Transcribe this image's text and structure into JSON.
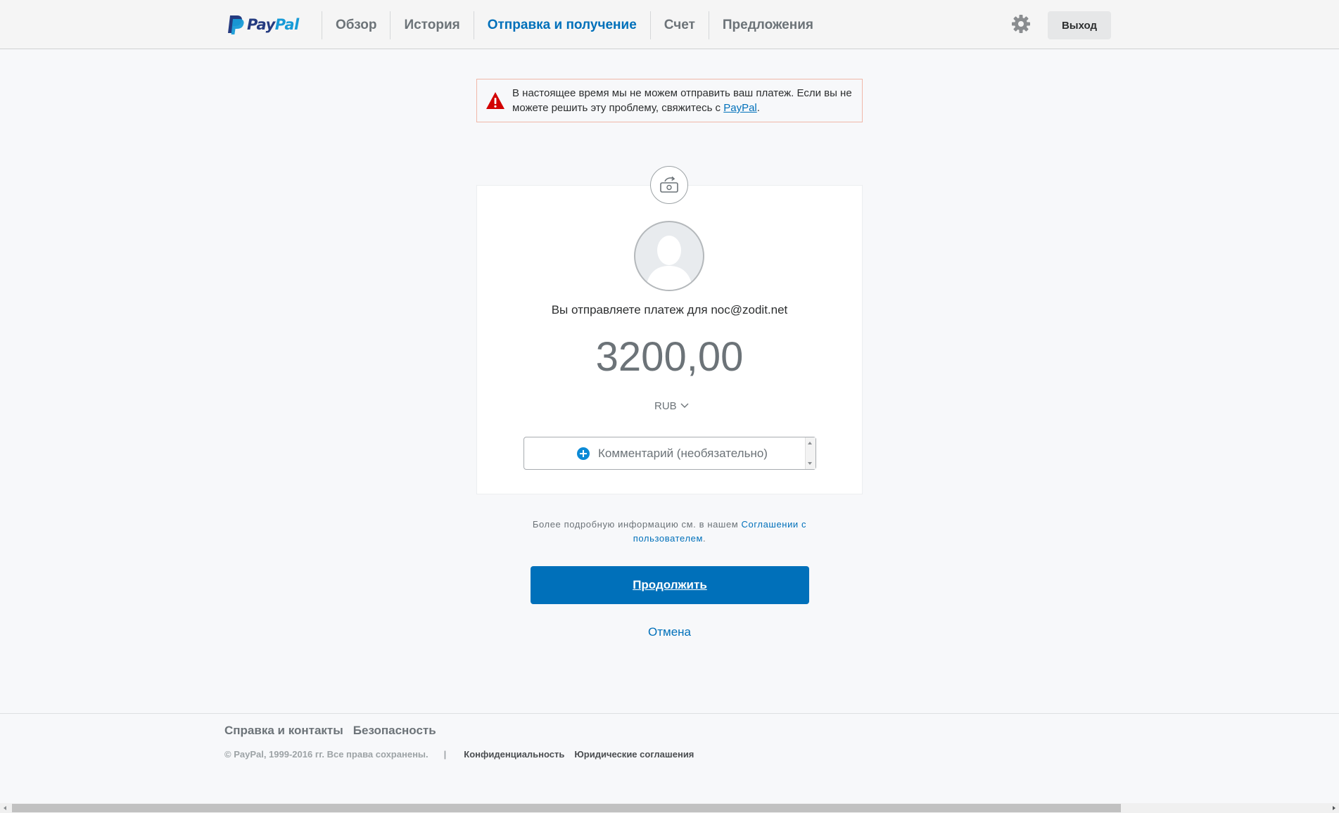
{
  "header": {
    "logo": {
      "pay": "Pay",
      "pal": "Pal"
    },
    "nav": [
      {
        "label": "Обзор",
        "active": false
      },
      {
        "label": "История",
        "active": false
      },
      {
        "label": "Отправка и получение",
        "active": true
      },
      {
        "label": "Счет",
        "active": false
      },
      {
        "label": "Предложения",
        "active": false
      }
    ],
    "settings_icon": "gear-icon",
    "logout_label": "Выход"
  },
  "alert": {
    "icon": "warning-icon",
    "text": "В настоящее время мы не можем отправить ваш платеж. Если вы не можете решить эту проблему, свяжитесь с ",
    "link_text": "PayPal",
    "suffix": "."
  },
  "payment": {
    "badge_icon": "send-money-icon",
    "recipient_text": "Вы отправляете платеж для noc@zodit.net",
    "amount": "3200,00",
    "currency": "RUB",
    "note_label": "Комментарий (необязательно)"
  },
  "agreement": {
    "text": "Более подробную информацию см. в нашем ",
    "link_text": "Соглашении с пользователем",
    "suffix": "."
  },
  "actions": {
    "continue_label": "Продолжить",
    "cancel_label": "Отмена"
  },
  "footer": {
    "links": [
      "Справка и контакты",
      "Безопасность"
    ],
    "copyright": "© PayPal, 1999-2016 гг. Все права сохранены.",
    "separator": "|",
    "legal_links": [
      "Конфиденциальность",
      "Юридические соглашения"
    ]
  },
  "colors": {
    "brand_blue": "#0070ba",
    "brand_dark": "#253b80",
    "brand_light": "#179bd7",
    "alert_red": "#d20000",
    "alert_border": "#f0b8a8"
  }
}
